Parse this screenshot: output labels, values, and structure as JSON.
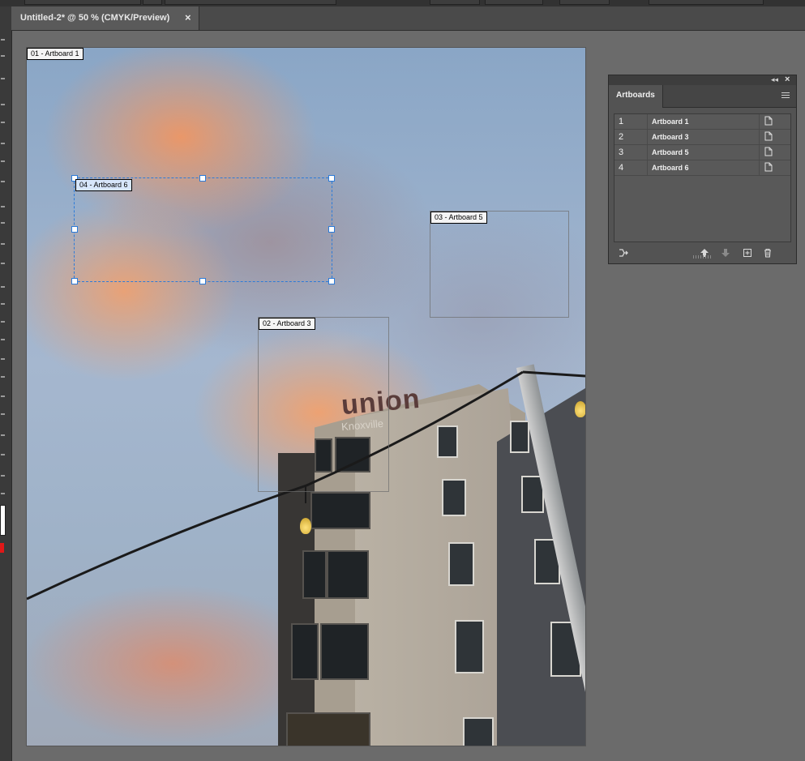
{
  "document": {
    "tab_title": "Untitled-2* @ 50 % (CMYK/Preview)",
    "close_glyph": "×"
  },
  "canvas": {
    "photo_text": {
      "sign_main": "union",
      "sign_sub": "Knoxville"
    },
    "artboard_labels": {
      "ab1": "01 - Artboard 1",
      "ab6": "04 - Artboard 6",
      "ab5": "03 - Artboard 5",
      "ab3": "02 - Artboard 3"
    }
  },
  "artboards_panel": {
    "tab_label": "Artboards",
    "collapse_glyph": "◂◂",
    "close_glyph": "×",
    "rows": [
      {
        "num": "1",
        "name": "Artboard 1"
      },
      {
        "num": "2",
        "name": "Artboard 3"
      },
      {
        "num": "3",
        "name": "Artboard 5"
      },
      {
        "num": "4",
        "name": "Artboard 6"
      }
    ],
    "footer_icons": [
      "rearrange-icon",
      "move-up-icon",
      "move-down-icon",
      "new-artboard-icon",
      "delete-icon"
    ]
  },
  "colors": {
    "selection_blue": "#2d7bd8",
    "fill_swatch": "#ffffff",
    "stroke_swatch": "#e01818"
  }
}
